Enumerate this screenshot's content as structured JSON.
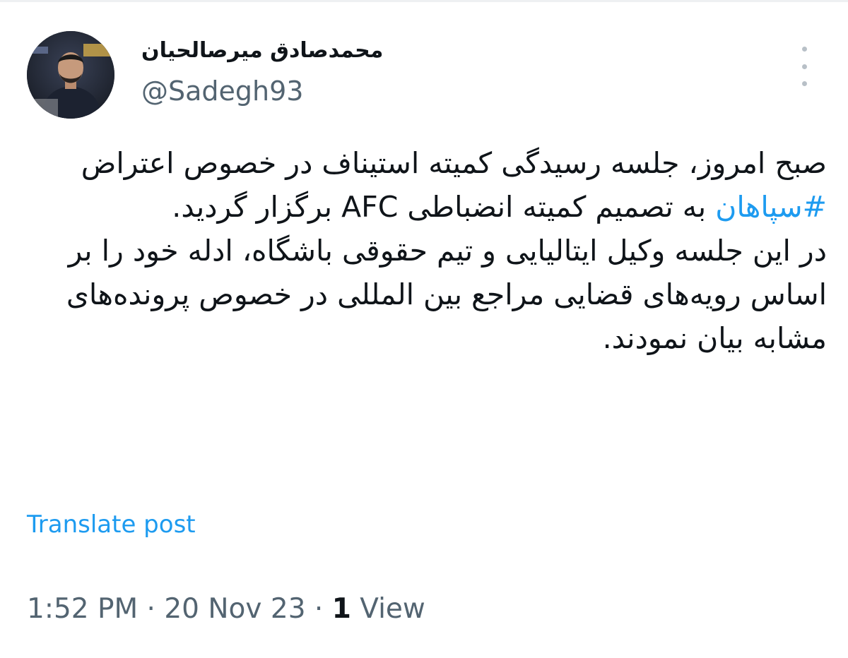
{
  "tweet": {
    "author": {
      "display_name": "محمدصادق میرصالحیان",
      "handle": "@Sadegh93"
    },
    "body": {
      "para1_before": "صبح امروز، جلسه رسیدگی کمیته استیناف در خصوص اعتراض ",
      "hashtag": "#سپاهان",
      "para1_after": " به تصمیم کمیته انضباطی AFC برگزار گردید.",
      "para2": "در این جلسه وکیل ایتالیایی و تیم حقوقی باشگاه، ادله خود را بر اساس رویه‌های قضایی مراجع بین المللی در خصوص پرونده‌های مشابه بیان نمودند."
    },
    "translate_label": "Translate post",
    "meta": {
      "time": "1:52 PM",
      "sep1": " · ",
      "date": "20 Nov 23",
      "sep2": " · ",
      "view_count": "1",
      "view_label": " View"
    }
  },
  "icons": {
    "more": "more-vertical-icon"
  },
  "colors": {
    "link": "#1d9bf0",
    "secondary_text": "#536471",
    "primary_text": "#0f1419"
  }
}
